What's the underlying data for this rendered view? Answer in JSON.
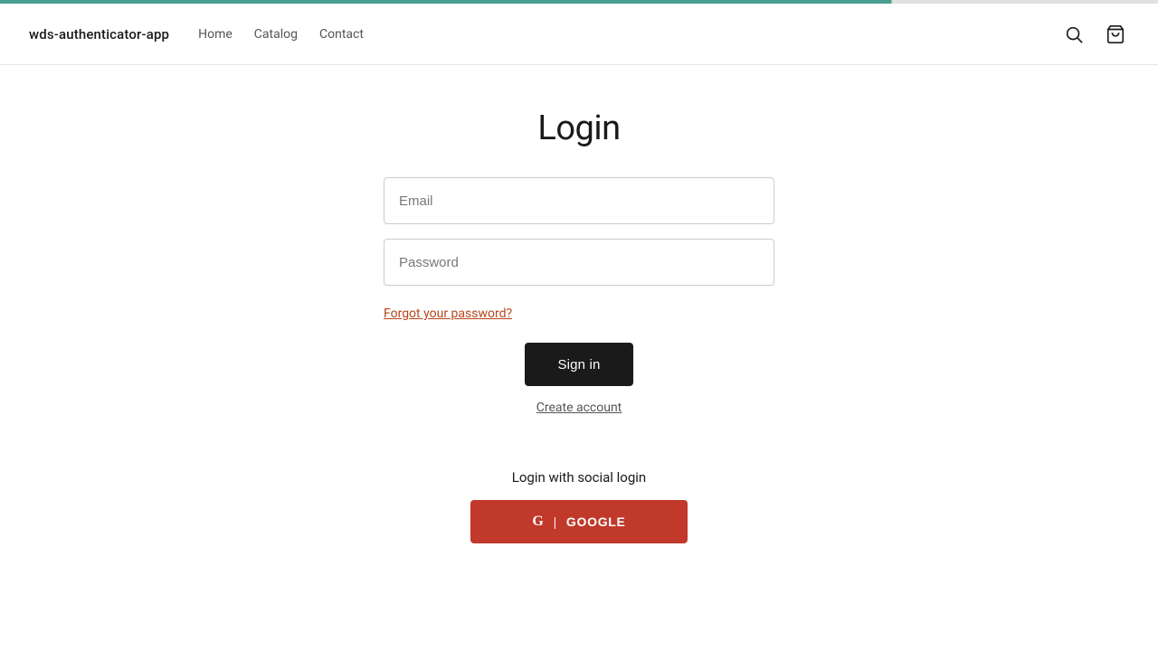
{
  "top_bar": {
    "progress": 77
  },
  "header": {
    "brand": "wds-authenticator-app",
    "nav": {
      "home": "Home",
      "catalog": "Catalog",
      "contact": "Contact"
    },
    "search_label": "Search",
    "cart_label": "Cart"
  },
  "main": {
    "page_title": "Login",
    "form": {
      "email_placeholder": "Email",
      "password_placeholder": "Password",
      "forgot_password_label": "Forgot your password?",
      "sign_in_label": "Sign in",
      "create_account_label": "Create account"
    },
    "social": {
      "label": "Login with social login",
      "google_label": "GOOGLE",
      "google_g": "G"
    }
  }
}
